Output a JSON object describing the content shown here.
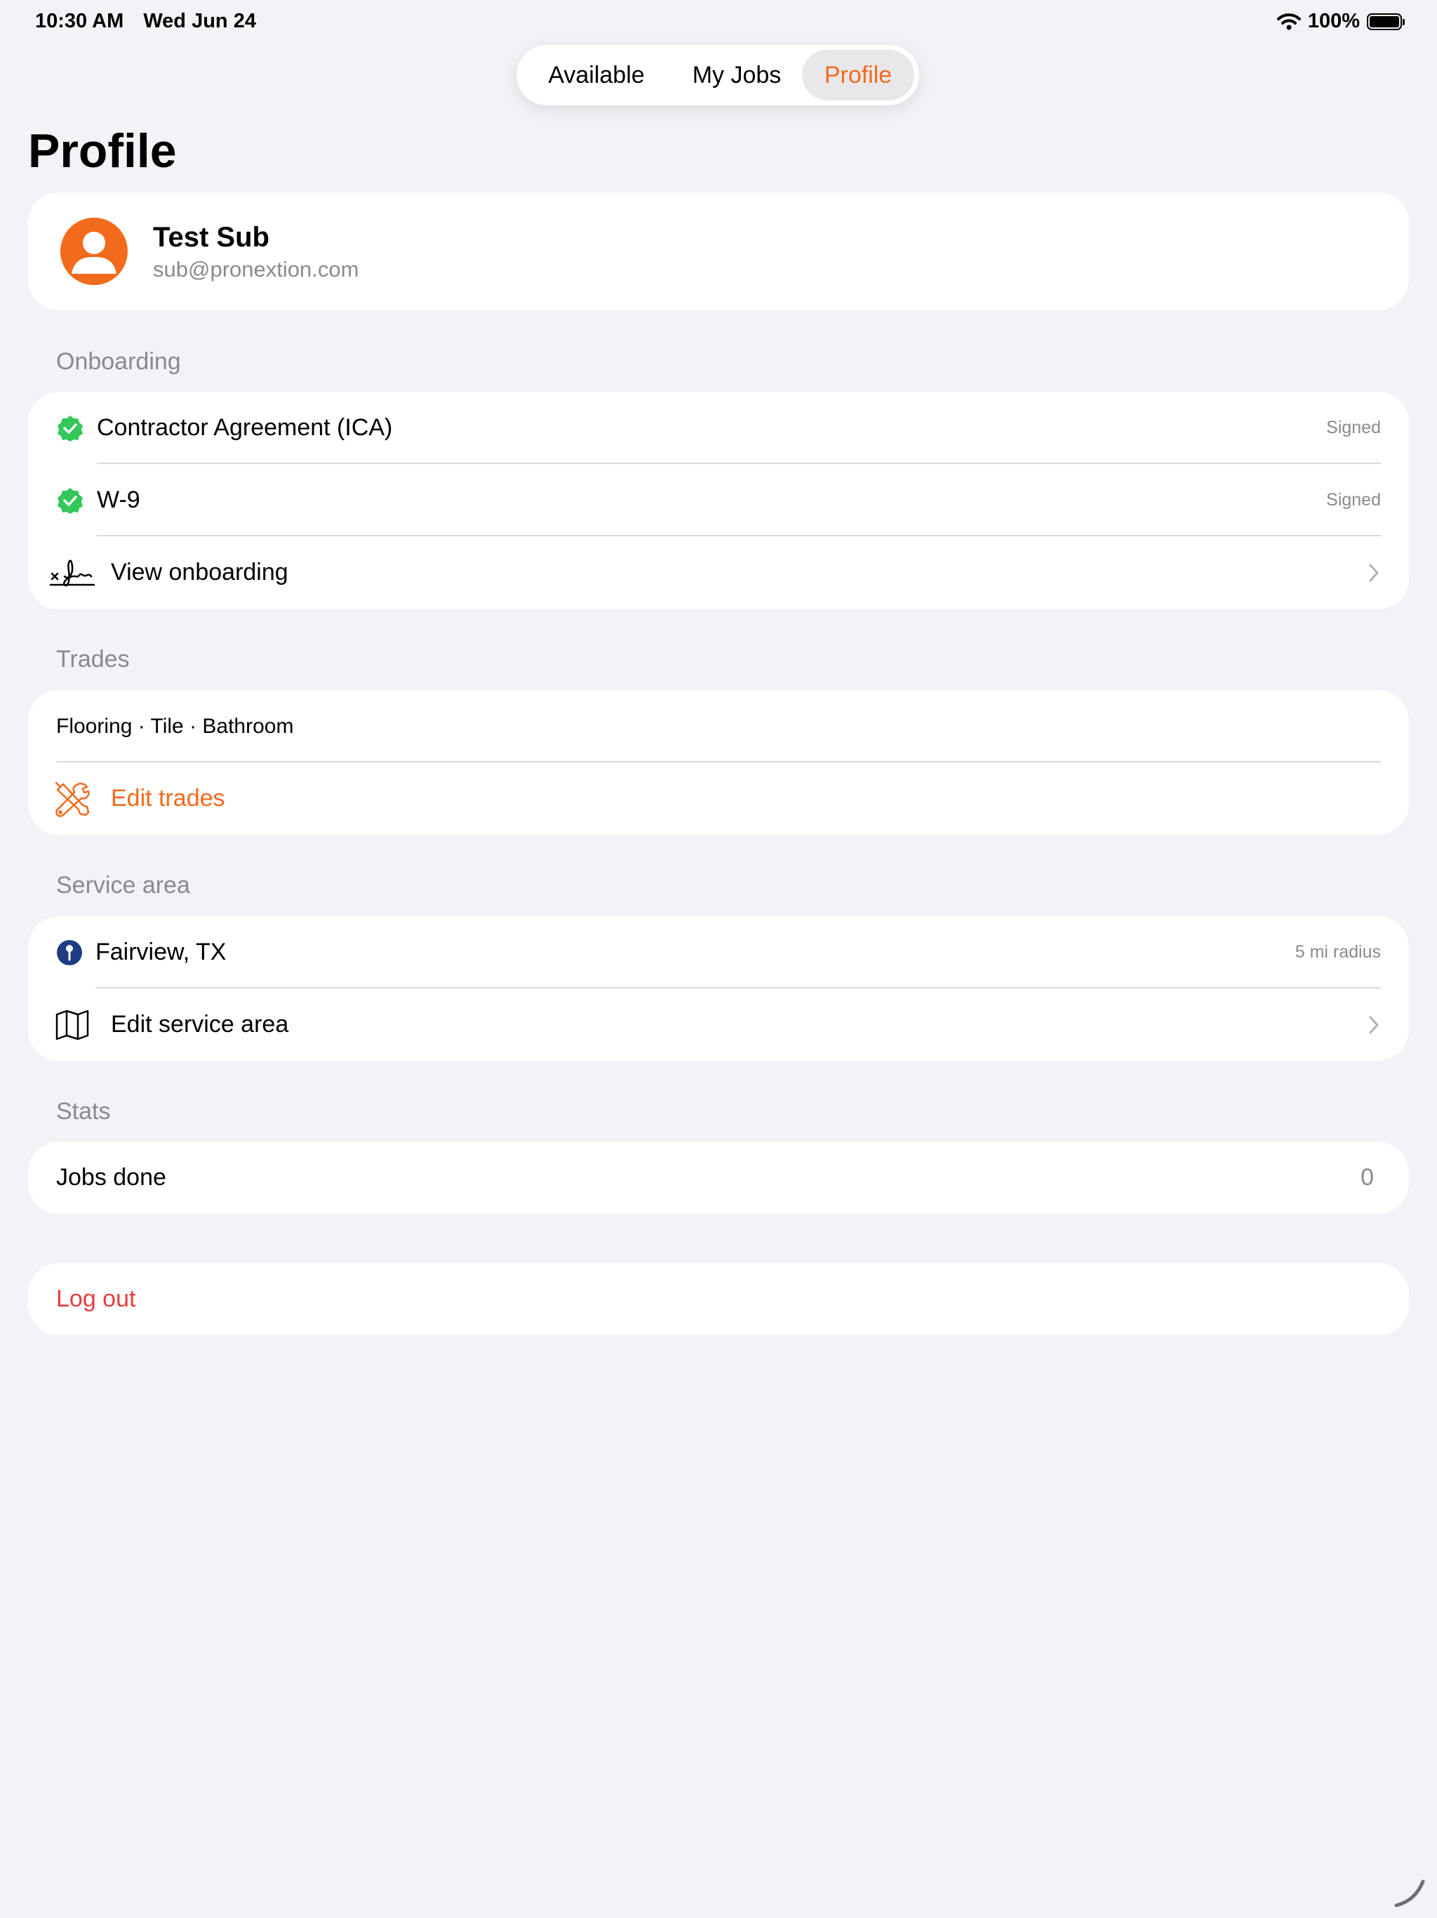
{
  "status_bar": {
    "time": "10:30 AM",
    "date": "Wed Jun 24",
    "battery": "100%"
  },
  "segmented": {
    "items": [
      "Available",
      "My Jobs",
      "Profile"
    ],
    "selected": "Profile"
  },
  "page": {
    "title": "Profile"
  },
  "profile": {
    "name": "Test Sub",
    "email": "sub@pronextion.com"
  },
  "onboarding": {
    "header": "Onboarding",
    "items": [
      {
        "label": "Contractor Agreement (ICA)",
        "status": "Signed"
      },
      {
        "label": "W-9",
        "status": "Signed"
      }
    ],
    "view_label": "View onboarding"
  },
  "trades": {
    "header": "Trades",
    "list": "Flooring · Tile · Bathroom",
    "edit_label": "Edit trades"
  },
  "service_area": {
    "header": "Service area",
    "location": "Fairview, TX",
    "radius": "5 mi radius",
    "edit_label": "Edit service area"
  },
  "stats": {
    "header": "Stats",
    "jobs_label": "Jobs done",
    "jobs_value": "0"
  },
  "logout": {
    "label": "Log out"
  },
  "colors": {
    "accent": "#f26a1b",
    "success": "#34c759",
    "destructive": "#ea3d3d",
    "pin": "#1f3b82"
  },
  "icons": [
    "wifi-icon",
    "battery-icon",
    "avatar-icon",
    "verified-check-icon",
    "signature-icon",
    "chevron-right-icon",
    "tools-icon",
    "map-pin-icon",
    "map-icon"
  ]
}
